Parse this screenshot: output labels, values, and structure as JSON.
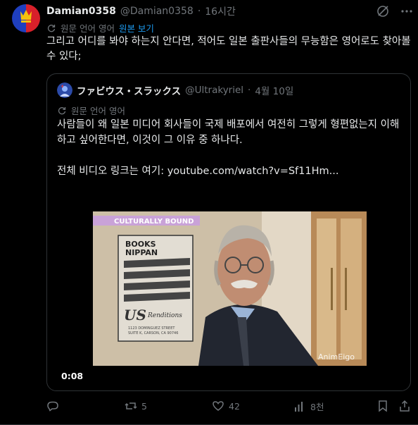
{
  "tweet": {
    "display_name": "Damian0358",
    "handle": "@Damian0358",
    "separator": "·",
    "time": "16시간",
    "translated_from": "원문 언어 영어",
    "show_original": "원본 보기",
    "text": "그리고 어디를 봐야 하는지 안다면, 적어도 일본 출판사들의 무능함은 영어로도 찾아볼 수 있다;"
  },
  "quote": {
    "display_name": "ファビウス・スラックス",
    "handle": "@Ultrakyriel",
    "separator": "·",
    "date": "4월 10일",
    "translated_from": "원문 언어 영어",
    "paragraph_1": "사람들이 왜 일본 미디어 회사들이 국제 배포에서 여전히 그렇게 형편없는지 이해하고 싶어한다면, 이것이 그 이유 중 하나다.",
    "paragraph_2": "전체 비디오 링크는 여기: youtube.com/watch?v=Sf11Hm...",
    "video": {
      "banner": "CULTURALLY BOUND",
      "poster_title_1": "BOOKS",
      "poster_title_2": "NIPPAN",
      "poster_logo_small": "US",
      "poster_logo": "Renditions",
      "poster_address_1": "1123 DOMINGUEZ STREET",
      "poster_address_2": "SUITE K, CARSON, CA 90746",
      "watermark": "AnimEigo",
      "timestamp": "0:08"
    }
  },
  "actions": {
    "reply_count": "",
    "retweet_count": "5",
    "like_count": "42",
    "views_count": "8천"
  },
  "colors": {
    "background": "#000000",
    "text": "#e7e9ea",
    "muted": "#71767b",
    "link": "#1d9bf0",
    "border": "#2f3336",
    "banner_purple": "#c9a2d8"
  }
}
